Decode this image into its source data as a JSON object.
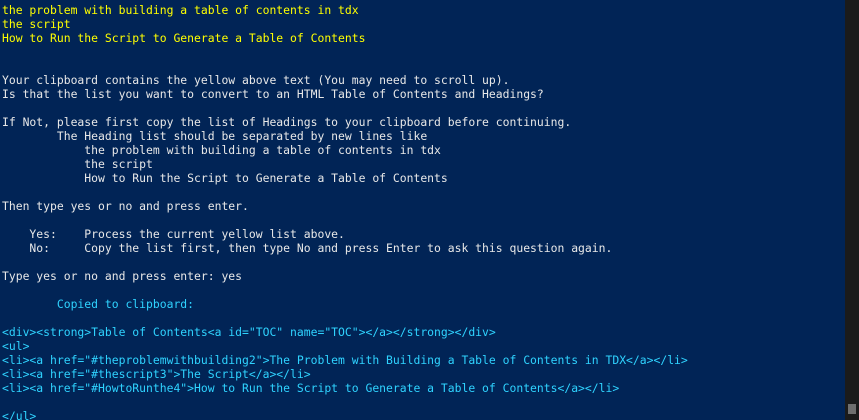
{
  "colors": {
    "background": "#012456",
    "default_text": "#e8e8e8",
    "highlight_yellow": "#ffff00",
    "html_cyan": "#2fd3ff"
  },
  "lines": [
    {
      "text": "the problem with building a table of contents in tdx",
      "color": "yellow"
    },
    {
      "text": "the script",
      "color": "yellow"
    },
    {
      "text": "How to Run the Script to Generate a Table of Contents",
      "color": "yellow"
    },
    {
      "text": "Your clipboard contains the yellow above text (You may need to scroll up).",
      "color": "white"
    },
    {
      "text": "Is that the list you want to convert to an HTML Table of Contents and Headings?",
      "color": "white"
    },
    {
      "text": "If Not, please first copy the list of Headings to your clipboard before continuing.",
      "color": "white"
    },
    {
      "text": "        The Heading list should be separated by new lines like",
      "color": "white"
    },
    {
      "text": "            the problem with building a table of contents in tdx",
      "color": "white"
    },
    {
      "text": "            the script",
      "color": "white"
    },
    {
      "text": "            How to Run the Script to Generate a Table of Contents",
      "color": "white"
    },
    {
      "text": "Then type yes or no and press enter.",
      "color": "white"
    },
    {
      "text": "    Yes:    Process the current yellow list above.",
      "color": "white"
    },
    {
      "text": "    No:     Copy the list first, then type No and press Enter to ask this question again.",
      "color": "white"
    },
    {
      "text": "Type yes or no and press enter: yes",
      "color": "white"
    },
    {
      "text": "        Copied to clipboard:",
      "color": "cyan"
    },
    {
      "text": "<div><strong>Table of Contents<a id=\"TOC\" name=\"TOC\"></a></strong></div>",
      "color": "cyan"
    },
    {
      "text": "<ul>",
      "color": "cyan"
    },
    {
      "text": "<li><a href=\"#theproblemwithbuilding2\">The Problem with Building a Table of Contents in TDX</a></li>",
      "color": "cyan"
    },
    {
      "text": "<li><a href=\"#thescript3\">The Script</a></li>",
      "color": "cyan"
    },
    {
      "text": "<li><a href=\"#HowtoRunthe4\">How to Run the Script to Generate a Table of Contents</a></li>",
      "color": "cyan"
    },
    {
      "text": "</ul>",
      "color": "cyan"
    }
  ]
}
